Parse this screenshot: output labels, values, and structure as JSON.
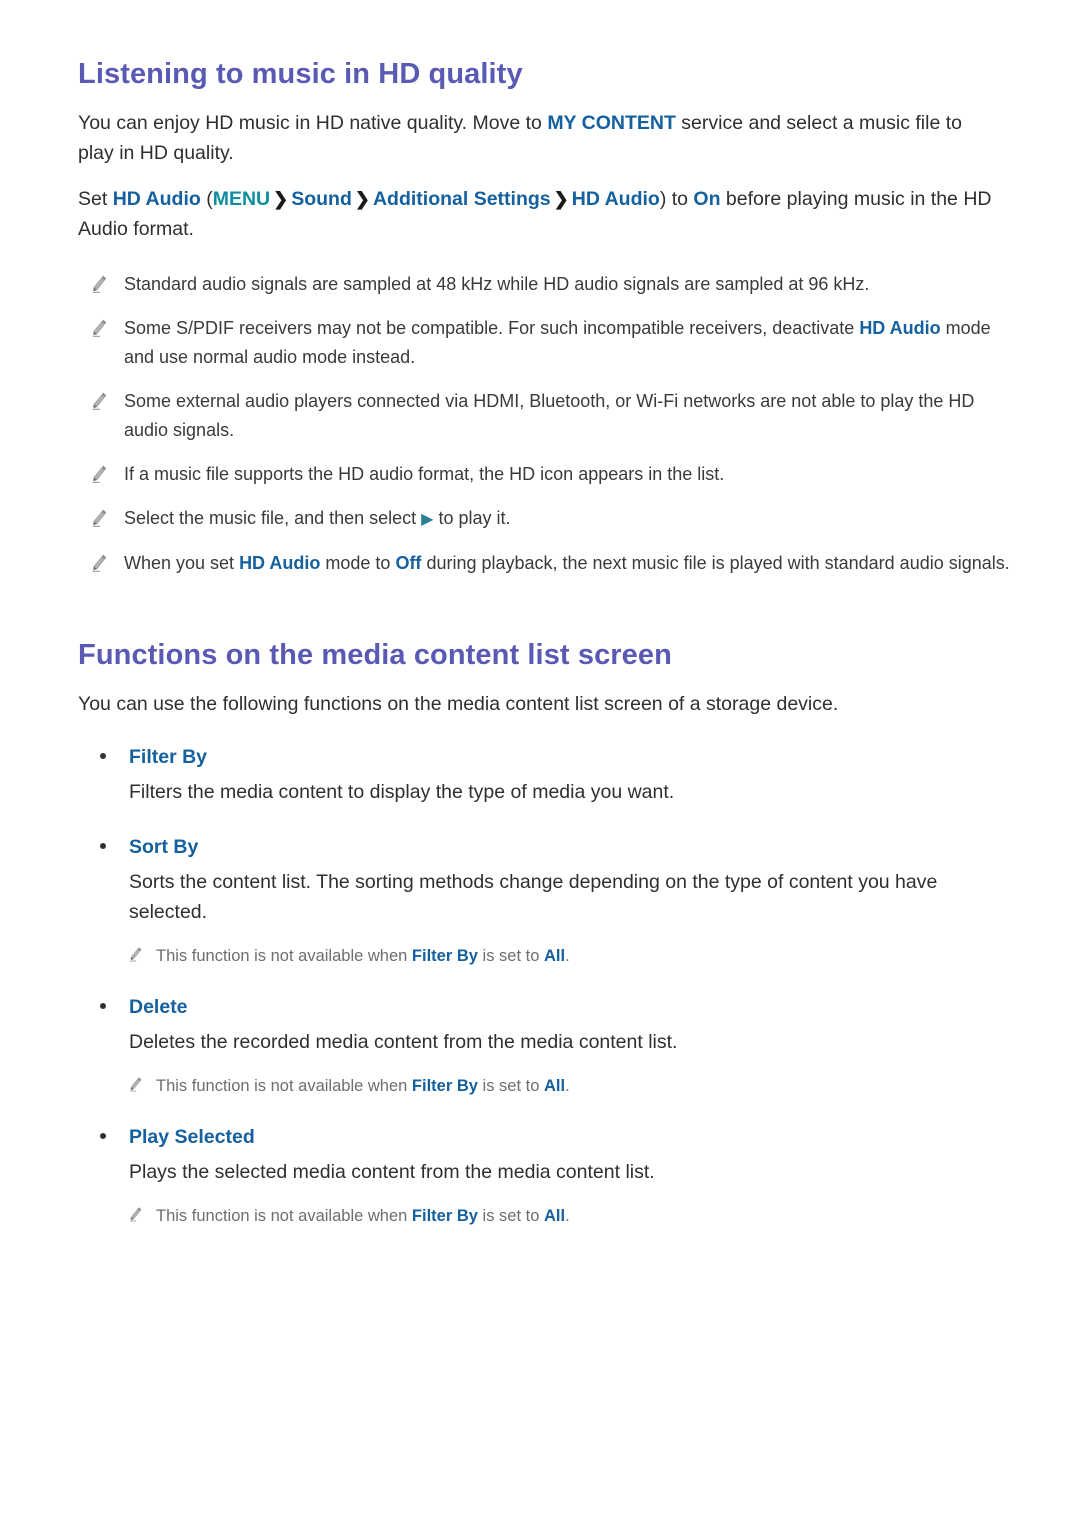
{
  "page": {
    "background_color": "#ffffff",
    "heading_color": "#5a5ab5",
    "accent_blue": "#15609e",
    "accent_teal": "#0e8d9e",
    "note_icon": "pencil-icon",
    "bullet_icon": "bullet-dot-icon",
    "play_icon": "play-triangle-icon"
  },
  "section1": {
    "heading": "Listening to music in HD quality",
    "intro": {
      "part1": "You can enjoy HD music in HD native quality. Move to ",
      "keyword1": "MY CONTENT",
      "part2": " service and select a music file to play in HD quality."
    },
    "setting": {
      "part1": "Set ",
      "keyword1": "HD Audio",
      "part2": " (",
      "keyword_menu": "MENU",
      "chevron1": "❯",
      "keyword2": "Sound",
      "chevron2": "❯",
      "keyword3": "Additional Settings",
      "chevron3": "❯",
      "keyword4": "HD Audio",
      "part3": ") to ",
      "keyword5": "On",
      "part4": " before playing music in the HD Audio format."
    },
    "notes": [
      {
        "id": "note-sample-rate",
        "text": "Standard audio signals are sampled at 48 kHz while HD audio signals are sampled at 96 kHz."
      },
      {
        "id": "note-spdif",
        "part1": "Some S/PDIF receivers may not be compatible. For such incompatible receivers, deactivate ",
        "keyword1": "HD Audio",
        "part2": " mode and use normal audio mode instead."
      },
      {
        "id": "note-external-players",
        "text": "Some external audio players connected via HDMI, Bluetooth, or Wi-Fi networks are not able to play the HD audio signals."
      },
      {
        "id": "note-hd-icon",
        "text": "If a music file supports the HD audio format, the HD icon appears in the list."
      },
      {
        "id": "note-select-play",
        "part1": "Select the music file, and then select ",
        "play_glyph": "▶",
        "part2": " to play it."
      },
      {
        "id": "note-hd-audio-off",
        "part1": "When you set ",
        "keyword1": "HD Audio",
        "part2": " mode to ",
        "keyword2": "Off",
        "part3": " during playback, the next music file is played with standard audio signals."
      }
    ]
  },
  "section2": {
    "heading": "Functions on the media content list screen",
    "intro": "You can use the following functions on the media content list screen of a storage device.",
    "items": [
      {
        "id": "filter-by",
        "label": "Filter By",
        "description": "Filters the media content to display the type of media you want.",
        "subnote": null
      },
      {
        "id": "sort-by",
        "label": "Sort By",
        "description": "Sorts the content list. The sorting methods change depending on the type of content you have selected.",
        "subnote": {
          "part1": "This function is not available when ",
          "keyword1": "Filter By",
          "part2": " is set to ",
          "keyword2": "All",
          "part3": "."
        }
      },
      {
        "id": "delete",
        "label": "Delete",
        "description": "Deletes the recorded media content from the media content list.",
        "subnote": {
          "part1": "This function is not available when ",
          "keyword1": "Filter By",
          "part2": " is set to ",
          "keyword2": "All",
          "part3": "."
        }
      },
      {
        "id": "play-selected",
        "label": "Play Selected",
        "description": "Plays the selected media content from the media content list.",
        "subnote": {
          "part1": "This function is not available when ",
          "keyword1": "Filter By",
          "part2": " is set to ",
          "keyword2": "All",
          "part3": "."
        }
      }
    ]
  }
}
